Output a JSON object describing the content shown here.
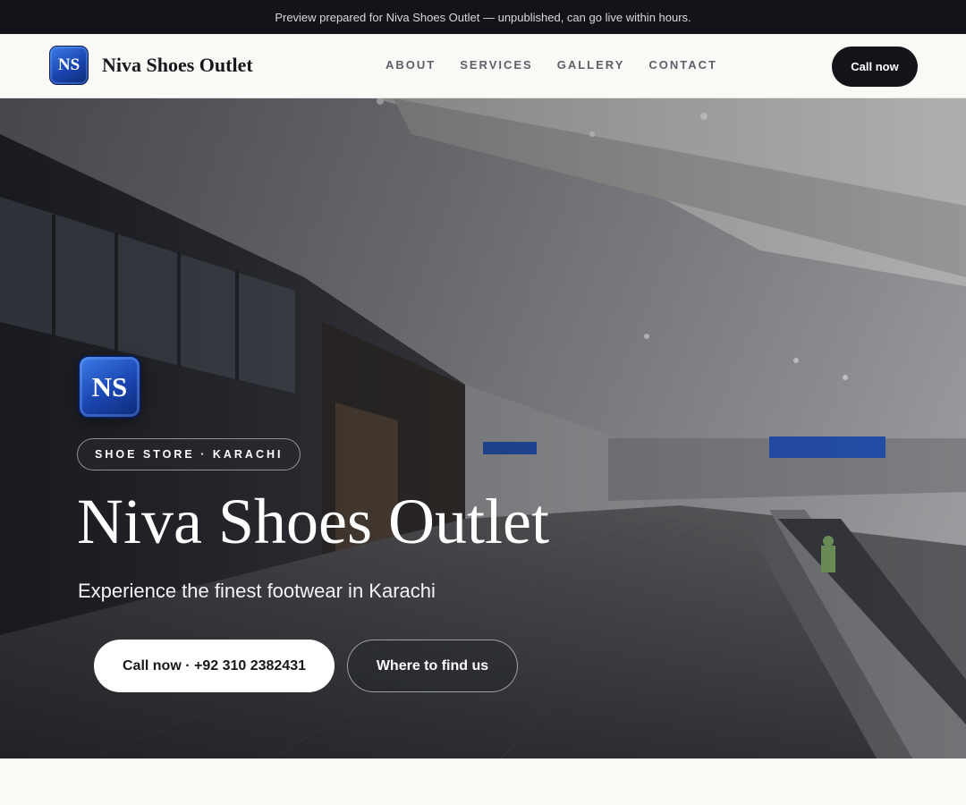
{
  "topbar": {
    "notice": "Preview prepared for Niva Shoes Outlet — unpublished, can go live within hours."
  },
  "navbar": {
    "logo_initials": "NS",
    "brand_name": "Niva Shoes Outlet",
    "links": [
      {
        "label": "ABOUT"
      },
      {
        "label": "SERVICES"
      },
      {
        "label": "GALLERY"
      },
      {
        "label": "CONTACT"
      }
    ],
    "cta_label": "Call now"
  },
  "hero": {
    "logo_initials": "NS",
    "eyebrow": "SHOE STORE · KARACHI",
    "title": "Niva Shoes Outlet",
    "subtitle": "Experience the finest footwear in Karachi",
    "primary_button": "Call now · +92 310 2382431",
    "secondary_button": "Where to find us"
  },
  "colors": {
    "dark": "#121419",
    "page_bg": "#faf9f6",
    "logo_blue": "#1a45b0"
  }
}
